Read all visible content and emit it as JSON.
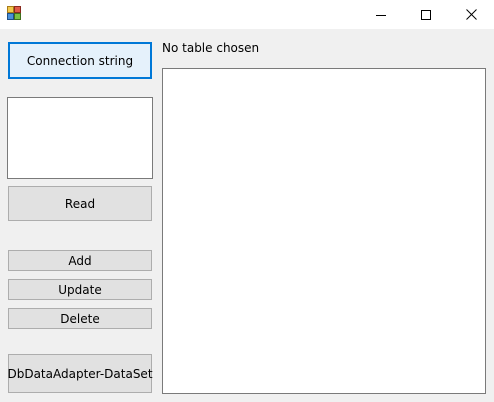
{
  "window": {
    "title": ""
  },
  "titlebar": {
    "icons": {
      "app": "app-icon",
      "minimize": "minimize-icon",
      "maximize": "maximize-icon",
      "close": "close-icon"
    }
  },
  "buttons": {
    "connection_string": "Connection string",
    "read": "Read",
    "add": "Add",
    "update": "Update",
    "delete": "Delete",
    "dbdataadapter_dataset": "DbDataAdapter-DataSet"
  },
  "status": {
    "table_label": "No table chosen"
  },
  "colors": {
    "accent": "#0078d7",
    "button_face": "#e1e1e1",
    "button_border": "#adadad",
    "window_bg": "#f0f0f0"
  }
}
